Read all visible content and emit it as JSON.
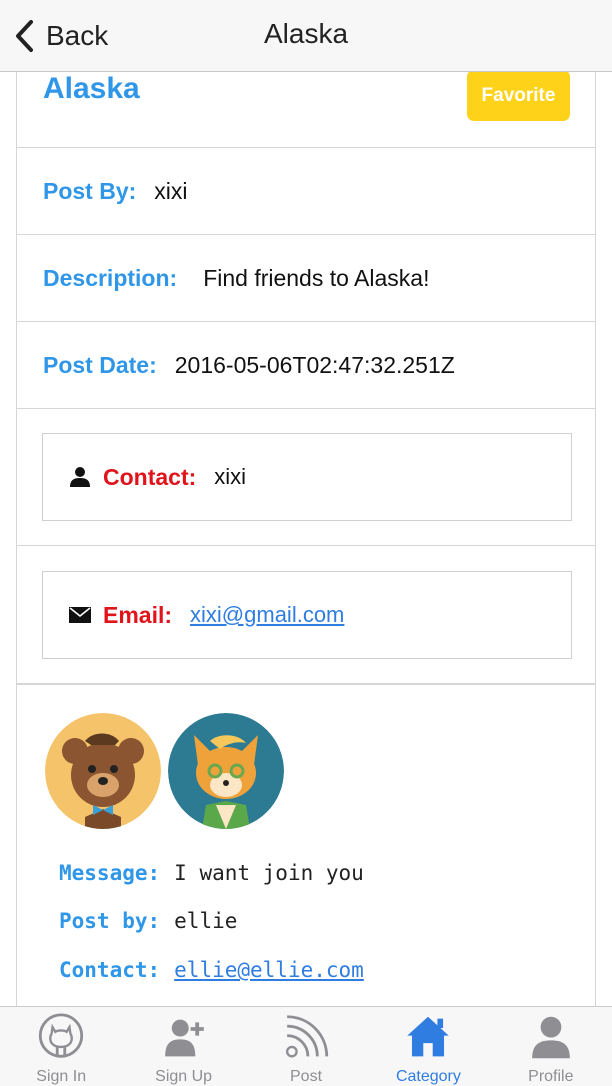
{
  "nav": {
    "back_label": "Back",
    "title": "Alaska"
  },
  "post": {
    "title": "Alaska",
    "favorite_label": "Favorite",
    "post_by_key": "Post By:",
    "post_by_value": "xixi",
    "description_key": "Description:",
    "description_value": "Find friends to Alaska!",
    "post_date_key": "Post Date:",
    "post_date_value": "2016-05-06T02:47:32.251Z"
  },
  "contact_card": {
    "key": "Contact:",
    "value": "xixi",
    "icon": "person-icon"
  },
  "email_card": {
    "key": "Email:",
    "value": "xixi@gmail.com",
    "icon": "envelope-icon"
  },
  "message": {
    "avatars": [
      "bear-avatar",
      "fox-avatar"
    ],
    "message_key": "Message:",
    "message_value": "I want join you",
    "post_by_key": "Post by:",
    "post_by_value": "ellie",
    "contact_key": "Contact:",
    "contact_value": "ellie@ellie.com"
  },
  "tabs": [
    {
      "label": "Sign In",
      "icon": "github-icon",
      "active": false
    },
    {
      "label": "Sign Up",
      "icon": "add-user-icon",
      "active": false
    },
    {
      "label": "Post",
      "icon": "rss-icon",
      "active": false
    },
    {
      "label": "Category",
      "icon": "home-icon",
      "active": true
    },
    {
      "label": "Profile",
      "icon": "person-icon",
      "active": false
    }
  ],
  "colors": {
    "accent_blue": "#2f96e8",
    "label_red": "#e0141a",
    "favorite_yellow": "#ffd21a",
    "active_tab": "#2f7de1",
    "inactive_tab": "#8e8e93"
  }
}
